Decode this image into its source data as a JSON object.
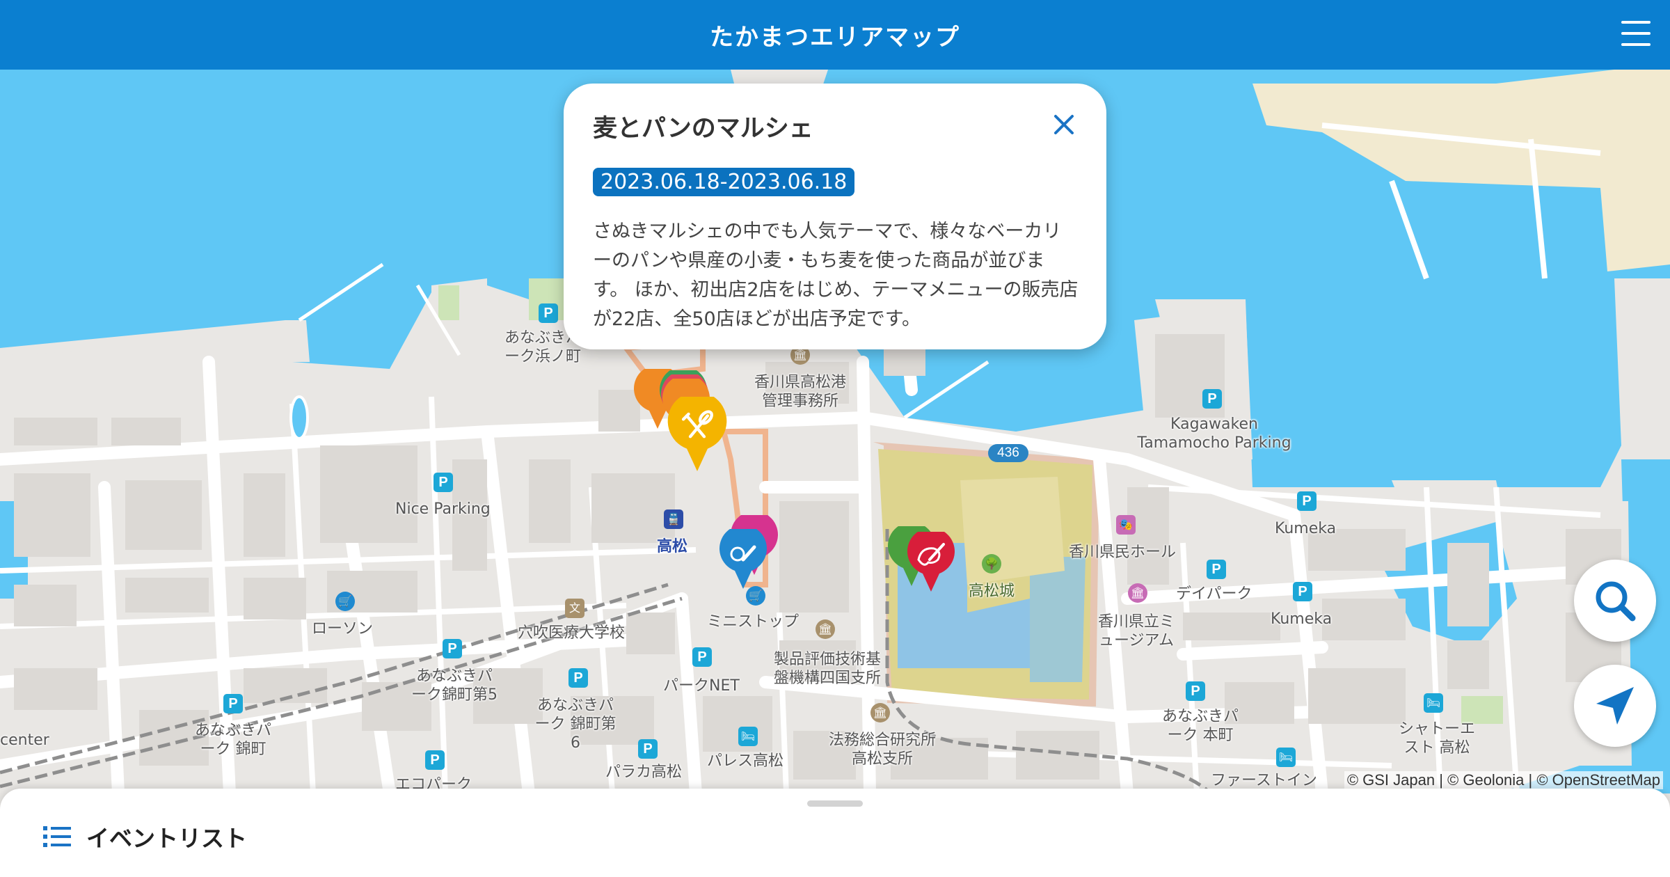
{
  "header": {
    "title": "たかまつエリアマップ",
    "menu_icon": "hamburger-menu-icon"
  },
  "popup": {
    "title": "麦とパンのマルシェ",
    "date_range": "2023.06.18-2023.06.18",
    "description": "さぬきマルシェの中でも人気テーマで、様々なベーカリーのパンや県産の小麦・もち麦を使った商品が並びます。 ほか、初出店2店をはじめ、テーマメニューの販売店が22店、全50店ほどが出店予定です。",
    "close_icon": "close-icon"
  },
  "map": {
    "labels": {
      "anabuki_hamanocho": "あなぶきパーク浜ノ町",
      "port_office": "香川県高松港管理事務所",
      "kagawaken_parking": "Kagawaken Tamamocho Parking",
      "route": "436",
      "nice_parking": "Nice Parking",
      "takamatsu_station": "高松",
      "lawson": "ローソン",
      "anabuki_nishikimachi": "あなぶきパーク 錦町",
      "center": "center",
      "anabuki_nishikimachi5": "あなぶきパーク錦町第5",
      "anabuki_nishikimachi6": "あなぶきパーク 錦町第6",
      "medical_school": "穴吹医療大学校",
      "ministop": "ミニストップ",
      "park_net": "パークNET",
      "nite": "製品評価技術基盤機構四国支所",
      "legal_institute": "法務総合研究所高松支所",
      "palace": "パレス高松",
      "paraka": "パラカ高松",
      "ecopark": "エコパーク",
      "castle": "高松城",
      "kenmin_hall": "香川県民ホール",
      "day_park": "デイパーク",
      "museum": "香川県立ミュージアム",
      "kumeka1": "Kumeka",
      "kumeka2": "Kumeka",
      "anabuki_honmachi": "あなぶきパーク 本町",
      "shato": "シャトーエスト 高松",
      "firstinn": "ファーストイン"
    },
    "parking_letter": "P",
    "attribution": "© GSI Japan | © Geolonia | © OpenStreetMap",
    "colors": {
      "sea": "#5fc7f5",
      "land": "#e9e7e4",
      "road": "#ffffff",
      "castle": "#ddd48e",
      "moat": "#8fc4e6",
      "header": "#0b7fd0"
    }
  },
  "fab": {
    "search_icon": "search-icon",
    "locate_icon": "navigation-arrow-icon"
  },
  "sheet": {
    "label": "イベントリスト",
    "icon": "list-icon"
  }
}
